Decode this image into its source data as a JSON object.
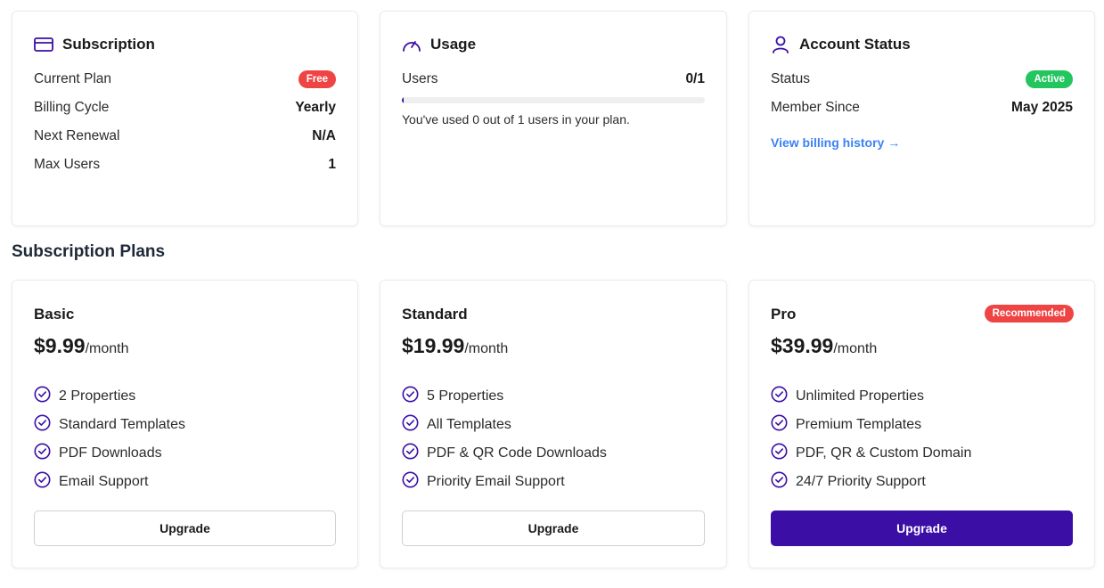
{
  "colors": {
    "accent": "#3b0ea5",
    "free_badge": "#ef4444",
    "active_badge": "#22c55e",
    "recommended_badge": "#ef4444",
    "link": "#3b82f6"
  },
  "subscription": {
    "title": "Subscription",
    "icon": "credit-card-icon",
    "current_plan_label": "Current Plan",
    "current_plan_badge": "Free",
    "billing_cycle_label": "Billing Cycle",
    "billing_cycle_value": "Yearly",
    "next_renewal_label": "Next Renewal",
    "next_renewal_value": "N/A",
    "max_users_label": "Max Users",
    "max_users_value": "1"
  },
  "usage": {
    "title": "Usage",
    "icon": "gauge-icon",
    "users_label": "Users",
    "users_value": "0/1",
    "progress_fraction": 0.0,
    "note": "You've used 0 out of 1 users in your plan."
  },
  "account": {
    "title": "Account Status",
    "icon": "user-icon",
    "status_label": "Status",
    "status_badge": "Active",
    "member_since_label": "Member Since",
    "member_since_value": "May 2025",
    "billing_history_link": "View billing history →"
  },
  "plans_section": {
    "title": "Subscription Plans",
    "plans": [
      {
        "name": "Basic",
        "price": "$9.99",
        "period": "/month",
        "features": [
          "2 Properties",
          "Standard Templates",
          "PDF Downloads",
          "Email Support"
        ],
        "button": "Upgrade"
      },
      {
        "name": "Standard",
        "price": "$19.99",
        "period": "/month",
        "features": [
          "5 Properties",
          "All Templates",
          "PDF & QR Code Downloads",
          "Priority Email Support"
        ],
        "button": "Upgrade"
      },
      {
        "name": "Pro",
        "badge": "Recommended",
        "price": "$39.99",
        "period": "/month",
        "features": [
          "Unlimited Properties",
          "Premium Templates",
          "PDF, QR & Custom Domain",
          "24/7 Priority Support"
        ],
        "button": "Upgrade"
      }
    ]
  }
}
